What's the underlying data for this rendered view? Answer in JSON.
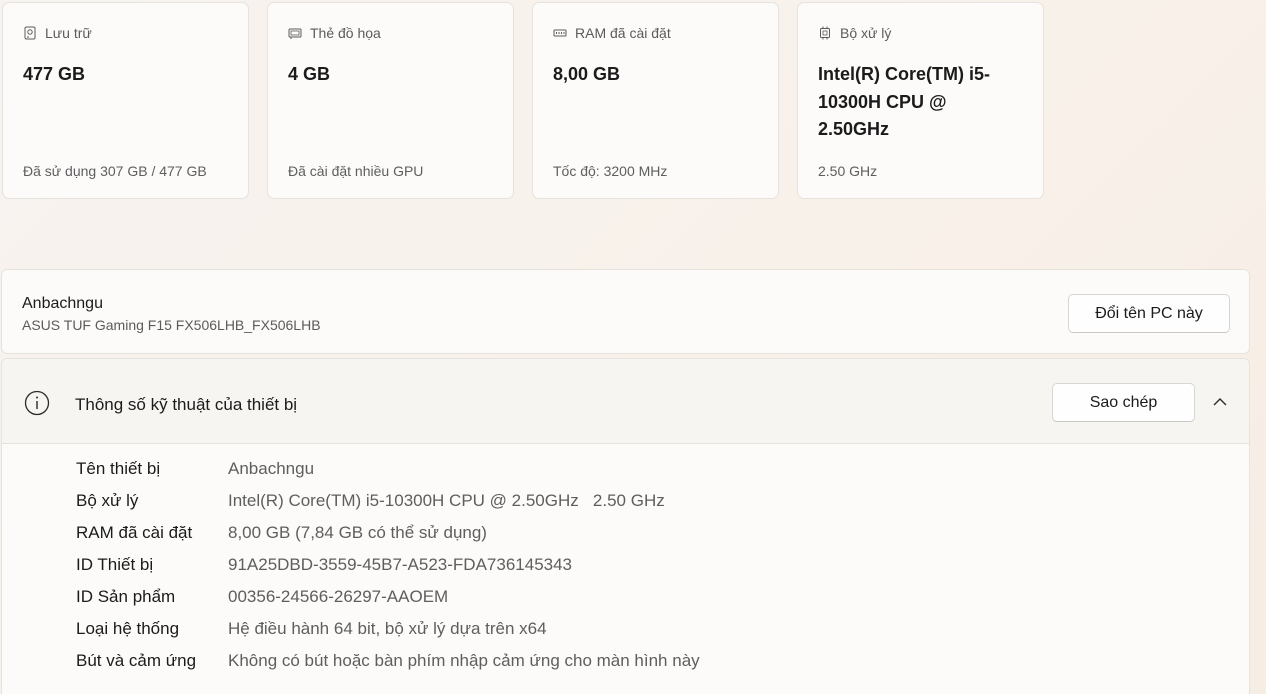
{
  "cards": [
    {
      "icon": "storage-drive-icon",
      "title": "Lưu trữ",
      "value": "477 GB",
      "subtitle": "Đã sử dụng 307 GB / 477 GB"
    },
    {
      "icon": "graphics-card-icon",
      "title": "Thẻ đồ họa",
      "value": "4 GB",
      "subtitle": "Đã cài đặt nhiều GPU"
    },
    {
      "icon": "ram-icon",
      "title": "RAM đã cài đặt",
      "value": "8,00 GB",
      "subtitle": "Tốc độ: 3200 MHz"
    },
    {
      "icon": "processor-chip-icon",
      "title": "Bộ xử lý",
      "value": "Intel(R) Core(TM) i5-10300H CPU @ 2.50GHz",
      "subtitle": "2.50 GHz"
    }
  ],
  "pc": {
    "name": "Anbachngu",
    "model": "ASUS TUF Gaming F15 FX506LHB_FX506LHB",
    "rename_label": "Đổi tên PC này"
  },
  "specs": {
    "title": "Thông số kỹ thuật của thiết bị",
    "copy_label": "Sao chép",
    "rows": [
      {
        "label": "Tên thiết bị",
        "value": "Anbachngu"
      },
      {
        "label": "Bộ xử lý",
        "value": "Intel(R) Core(TM) i5-10300H CPU @ 2.50GHz   2.50 GHz"
      },
      {
        "label": "RAM đã cài đặt",
        "value": "8,00 GB (7,84 GB có thể sử dụng)"
      },
      {
        "label": "ID Thiết bị",
        "value": "91A25DBD-3559-45B7-A523-FDA736145343"
      },
      {
        "label": "ID Sản phẩm",
        "value": "00356-24566-26297-AAOEM"
      },
      {
        "label": "Loại hệ thống",
        "value": "Hệ điều hành 64 bit, bộ xử lý dựa trên x64"
      },
      {
        "label": "Bút và cảm ứng",
        "value": "Không có bút hoặc bàn phím nhập cảm ứng cho màn hình này"
      }
    ]
  }
}
